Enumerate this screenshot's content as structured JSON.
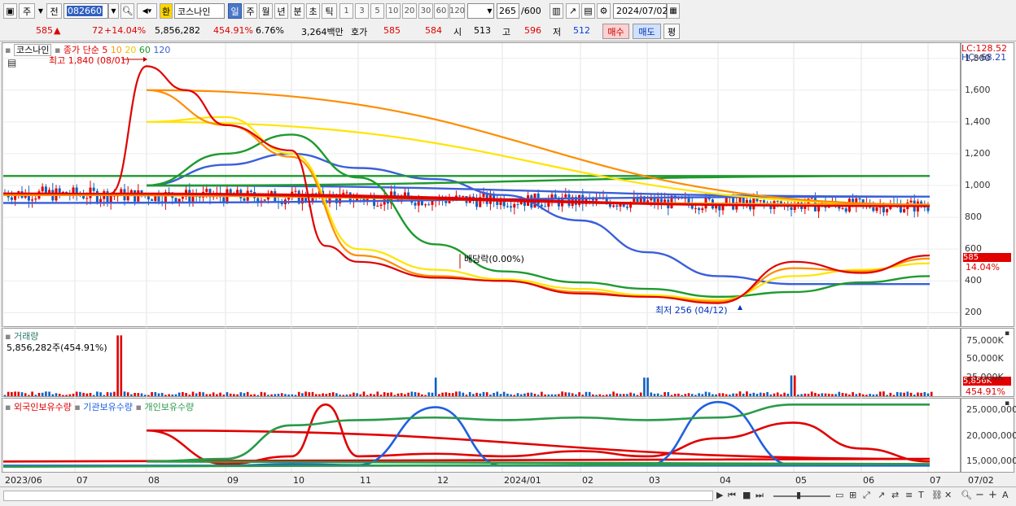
{
  "toolbar": {
    "type_label": "주",
    "prev_label": "전",
    "code": "082660",
    "currency_label": "환",
    "name": "코스나인",
    "periods": [
      "일",
      "주",
      "월",
      "년",
      "분",
      "초",
      "틱"
    ],
    "intervals": [
      "1",
      "3",
      "5",
      "10",
      "20",
      "30",
      "60",
      "120"
    ],
    "count": "265",
    "count_max": "/600",
    "date": "2024/07/02"
  },
  "quote": {
    "price": "585",
    "arrow": "▲",
    "change": "72",
    "change_pct": "+14.04%",
    "volume": "5,856,282",
    "volume_ratio": "454.91%",
    "turnover_pct": "6.76%",
    "amount": "3,264백만",
    "ask_label": "호가",
    "ask": "585",
    "bid": "584",
    "open_label": "시",
    "open": "513",
    "high_label": "고",
    "high": "596",
    "low_label": "저",
    "low": "512",
    "buy_label": "매수",
    "sell_label": "매도",
    "eval_label": "평"
  },
  "price_panel": {
    "name": "코스나인",
    "ma_title": "종가 단순",
    "ma_periods": [
      "5",
      "10",
      "20",
      "60",
      "120"
    ],
    "high_note": "최고 1,840 (08/01)",
    "low_note": "최저 256 (04/12)",
    "dividend_note": "배당락(0.00%)",
    "lc": "LC:128.52",
    "hc": "HC:-68.21",
    "last_price": "585",
    "last_pct": "14.04%"
  },
  "volume_panel": {
    "title": "거래량",
    "value": "5,856,282주(454.91%)",
    "last_value": "5,856K",
    "last_pct": "454.91%"
  },
  "holdings_panel": {
    "series_labels": [
      "외국인보유수량",
      "기관보유수량",
      "개인보유수량"
    ]
  },
  "colors": {
    "ma5": "#e00000",
    "ma10": "#ff8c00",
    "ma20": "#ffe400",
    "ma60": "#1e9a2e",
    "ma120": "#3a5fd8",
    "up": "#e00000",
    "down": "#1060c0",
    "foreign": "#e00000",
    "institution": "#2060e0",
    "individual": "#2a9a4a"
  },
  "chart_data": [
    {
      "type": "candlestick",
      "x_ticks": [
        "2023/06",
        "07",
        "08",
        "09",
        "10",
        "11",
        "12",
        "2024/01",
        "02",
        "03",
        "04",
        "05",
        "06",
        "07",
        "07/02"
      ],
      "yticks": [
        200,
        400,
        600,
        800,
        1000,
        1200,
        1400,
        1600,
        1800
      ],
      "ylim": [
        120,
        1880
      ],
      "series": [
        {
          "name": "5",
          "x": [
            "2023/06",
            "07",
            "07 mid",
            "08",
            "08 mid",
            "09",
            "10",
            "10 mid",
            "11",
            "12",
            "2024/01",
            "02",
            "03",
            "04",
            "05",
            "06",
            "07"
          ],
          "values": [
            950,
            870,
            950,
            1750,
            1600,
            1380,
            1220,
            620,
            520,
            420,
            400,
            320,
            300,
            260,
            520,
            450,
            560
          ]
        },
        {
          "name": "10",
          "x": [
            "2023/06",
            "07",
            "08",
            "09",
            "10",
            "11",
            "12",
            "2024/01",
            "02",
            "03",
            "04",
            "05",
            "06",
            "07"
          ],
          "values": [
            940,
            880,
            1600,
            1380,
            1180,
            560,
            430,
            400,
            330,
            300,
            270,
            480,
            460,
            540
          ]
        },
        {
          "name": "20",
          "x": [
            "2023/06",
            "07",
            "08",
            "09",
            "10",
            "11",
            "12",
            "2024/01",
            "02",
            "03",
            "04",
            "05",
            "06",
            "07"
          ],
          "values": [
            940,
            880,
            1400,
            1430,
            1200,
            600,
            470,
            410,
            350,
            310,
            280,
            430,
            470,
            510
          ]
        },
        {
          "name": "60",
          "x": [
            "2023/06",
            "07",
            "08",
            "09",
            "10",
            "11",
            "12",
            "2024/01",
            "02",
            "03",
            "04",
            "05",
            "06",
            "07"
          ],
          "values": [
            1060,
            1060,
            1000,
            1200,
            1320,
            1050,
            630,
            460,
            390,
            350,
            300,
            330,
            390,
            430
          ]
        },
        {
          "name": "120",
          "x": [
            "2023/06",
            "07",
            "08",
            "09",
            "10",
            "11",
            "12",
            "2024/01",
            "02",
            "03",
            "04",
            "05",
            "06",
            "07"
          ],
          "values": [
            890,
            930,
            1000,
            1130,
            1200,
            1110,
            1040,
            940,
            780,
            580,
            430,
            380,
            380,
            380
          ]
        }
      ]
    },
    {
      "type": "bar",
      "yticks": [
        "25,000K",
        "50,000K",
        "75,000K"
      ],
      "ylim": [
        0,
        90000000
      ],
      "highlights": [
        {
          "x": "08",
          "value": 82000000
        },
        {
          "x": "12",
          "value": 25000000
        },
        {
          "x": "03",
          "value": 25000000
        },
        {
          "x": "05",
          "value": 28000000
        },
        {
          "x": "07/02",
          "value": 5856282
        }
      ]
    },
    {
      "type": "line",
      "yticks": [
        "15,000,000",
        "20,000,000",
        "25,000,000"
      ],
      "ylim": [
        13000000,
        27000000
      ],
      "series": [
        {
          "name": "외국인보유수량",
          "x": [
            "2023/06",
            "07",
            "08",
            "09",
            "10",
            "10 mid",
            "11",
            "12",
            "2024/01",
            "02",
            "03",
            "04",
            "05",
            "06",
            "07"
          ],
          "values": [
            15000000,
            15500000,
            21000000,
            14500000,
            16000000,
            26000000,
            16000000,
            16500000,
            16000000,
            17000000,
            16000000,
            19500000,
            22500000,
            17500000,
            15000000
          ]
        },
        {
          "name": "기관보유수량",
          "x": [
            "2023/06",
            "07",
            "08",
            "09",
            "10",
            "11",
            "12",
            "2024/01",
            "02",
            "03",
            "04",
            "05",
            "06",
            "07"
          ],
          "values": [
            14200000,
            14200000,
            14200000,
            14200000,
            14500000,
            14300000,
            25500000,
            14200000,
            14200000,
            14200000,
            26500000,
            14200000,
            14200000,
            14200000
          ]
        },
        {
          "name": "개인보유수량",
          "x": [
            "2023/06",
            "07",
            "08",
            "09",
            "10",
            "11",
            "12",
            "2024/01",
            "02",
            "03",
            "04",
            "05",
            "06",
            "07"
          ],
          "values": [
            14000000,
            14500000,
            15000000,
            15500000,
            22000000,
            23000000,
            23500000,
            23000000,
            23500000,
            23000000,
            23500000,
            26000000,
            26000000,
            26000000
          ]
        }
      ]
    }
  ]
}
